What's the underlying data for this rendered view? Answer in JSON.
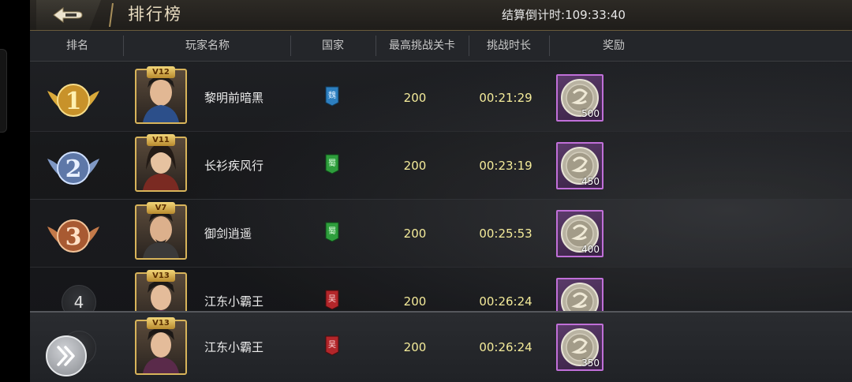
{
  "title": "排行榜",
  "countdown": {
    "label": "结算倒计时:",
    "value": "109:33:40"
  },
  "columns": [
    "排名",
    "玩家名称",
    "国家",
    "最高挑战关卡",
    "挑战时长",
    "奖励"
  ],
  "rows": [
    {
      "rank": "1",
      "vip": "V12",
      "name": "黎明前暗黑",
      "country": "魏",
      "country_color": "#2d7fc0",
      "level": "200",
      "time": "00:21:29",
      "reward": "500"
    },
    {
      "rank": "2",
      "vip": "V11",
      "name": "长衫疾风行",
      "country": "蜀",
      "country_color": "#2e9e3c",
      "level": "200",
      "time": "00:23:19",
      "reward": "450"
    },
    {
      "rank": "3",
      "vip": "V7",
      "name": "御剑逍遥",
      "country": "蜀",
      "country_color": "#2e9e3c",
      "level": "200",
      "time": "00:25:53",
      "reward": "400"
    },
    {
      "rank": "4",
      "vip": "V13",
      "name": "江东小霸王",
      "country": "吴",
      "country_color": "#b3262a",
      "level": "200",
      "time": "00:26:24",
      "reward": ""
    }
  ],
  "self_row": {
    "rank": "4",
    "vip": "V13",
    "name": "江东小霸王",
    "country": "吴",
    "country_color": "#b3262a",
    "level": "200",
    "time": "00:26:24",
    "reward": "350"
  },
  "colors": {
    "gold_text": "#f4eb9a",
    "reward_border": "#c06fd8",
    "accent": "#d8b45a"
  },
  "icons": {
    "back": "back-arrow-icon",
    "expand": "double-chevron-right-icon",
    "reward": "silver-coin-icon"
  }
}
